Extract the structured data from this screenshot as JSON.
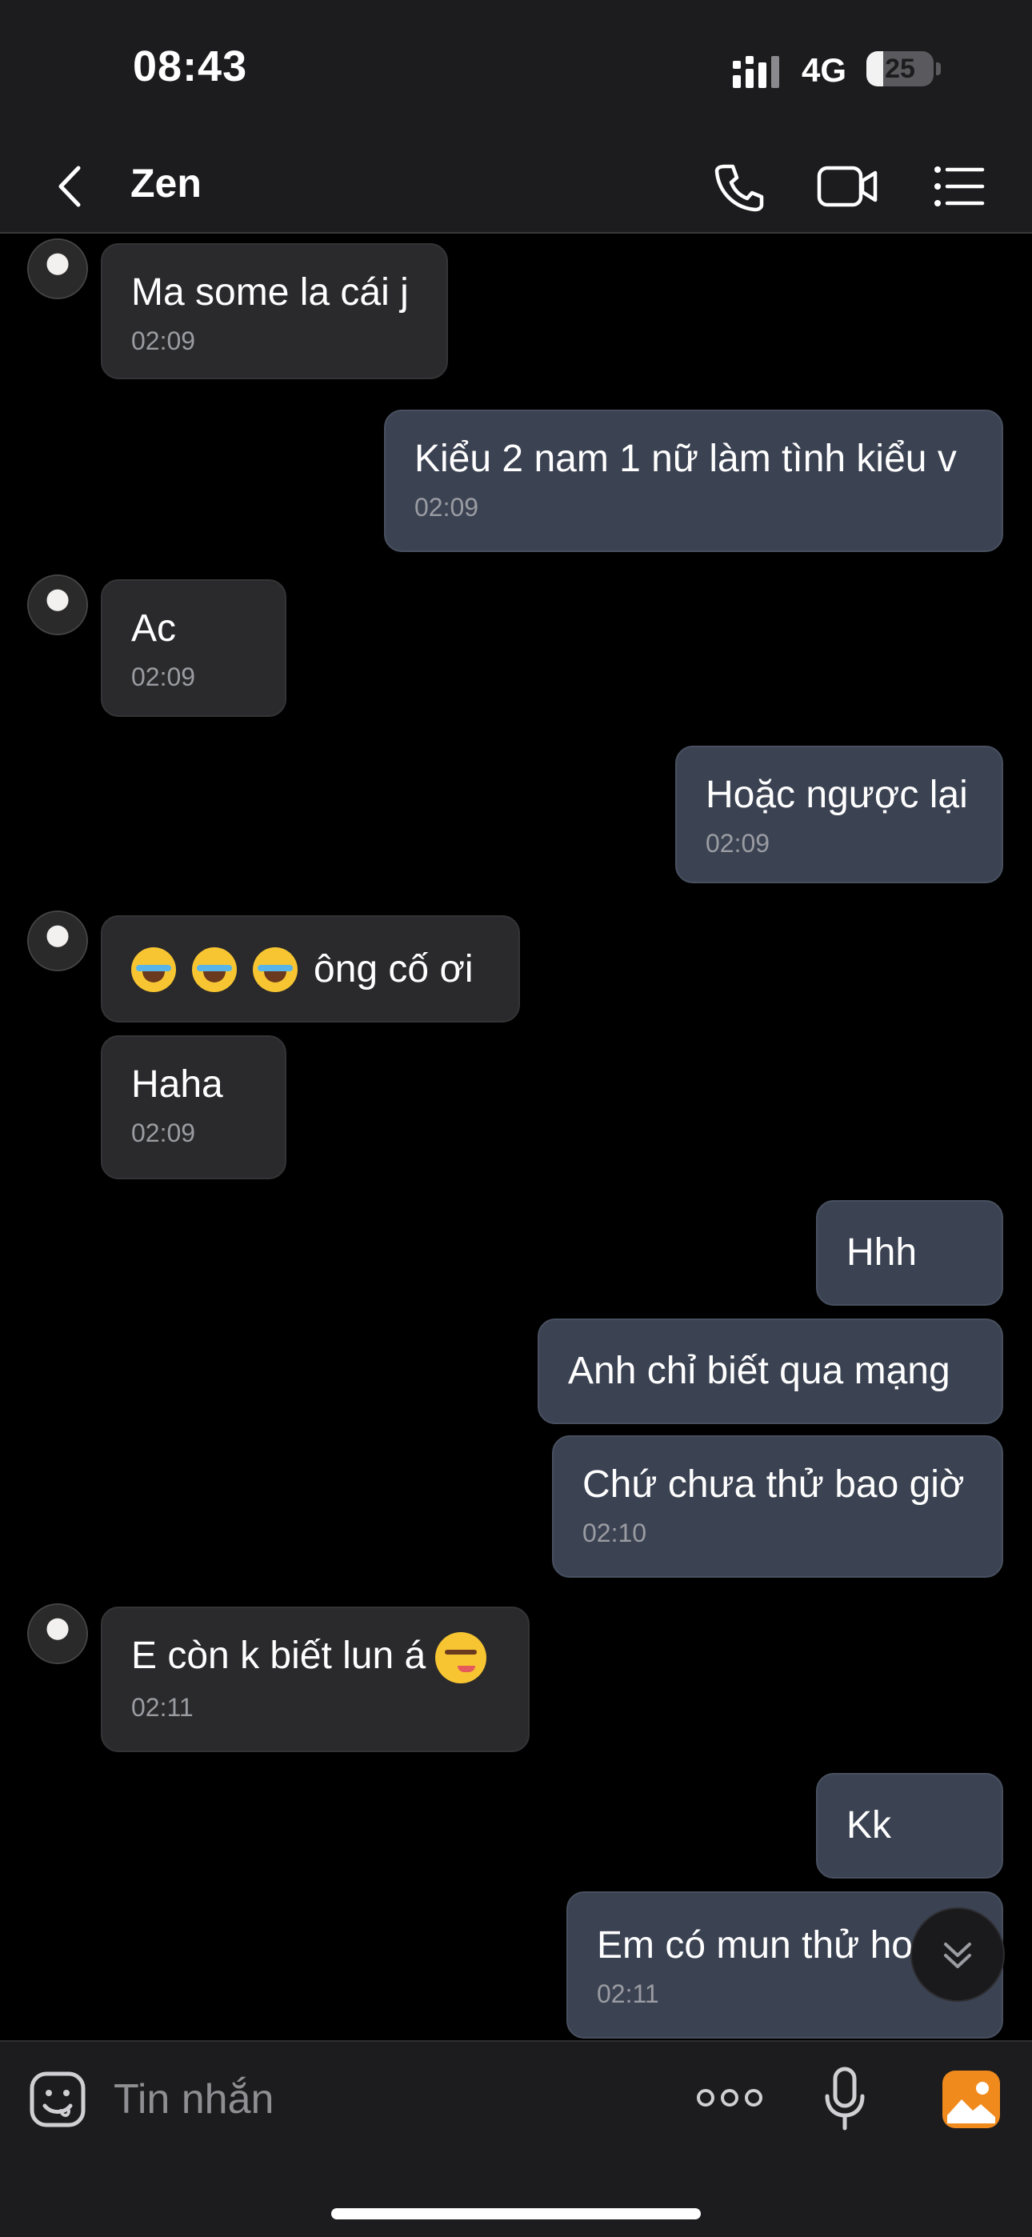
{
  "status_bar": {
    "time": "08:43",
    "network": "4G",
    "battery": "25",
    "battery_level": 0.25
  },
  "header": {
    "contact_name": "Zen",
    "icons": [
      "back-icon",
      "phone-icon",
      "video-icon",
      "list-icon"
    ]
  },
  "messages": [
    {
      "side": "in",
      "text": "Ma some la cái j",
      "time": "02:09"
    },
    {
      "side": "out",
      "text": "Kiểu 2 nam 1 nữ làm tình kiểu v",
      "time": "02:09"
    },
    {
      "side": "in",
      "text": "Ac",
      "time": "02:09"
    },
    {
      "side": "out",
      "text": "Hoặc ngược lại",
      "time": "02:09"
    },
    {
      "side": "in",
      "text": "ông cố ơi",
      "emoji": [
        "laugh-emoji",
        "laugh-emoji",
        "laugh-emoji"
      ]
    },
    {
      "side": "in",
      "text": "Haha",
      "time": "02:09"
    },
    {
      "side": "out",
      "text": "Hhh"
    },
    {
      "side": "out",
      "text": "Anh chỉ biết qua mạng"
    },
    {
      "side": "out",
      "text": "Chứ chưa thử bao giờ",
      "time": "02:10"
    },
    {
      "side": "in",
      "text": "E còn k biết lun á",
      "emoji": [
        "smirk-emoji"
      ],
      "time": "02:11"
    },
    {
      "side": "out",
      "text": "Kk"
    },
    {
      "side": "out",
      "text": "Em có mun thử ho",
      "time": "02:11"
    }
  ],
  "input_bar": {
    "placeholder": "Tin nhắn",
    "icons": [
      "sticker-icon",
      "more-icon",
      "mic-icon",
      "gallery-icon"
    ]
  },
  "colors": {
    "background": "#000000",
    "bar_background": "#1c1c1e",
    "incoming_bubble": "#2a2a2c",
    "outgoing_bubble": "#3b4252",
    "gallery_accent": "#f08a1d",
    "timestamp": "#9a9ca2"
  }
}
